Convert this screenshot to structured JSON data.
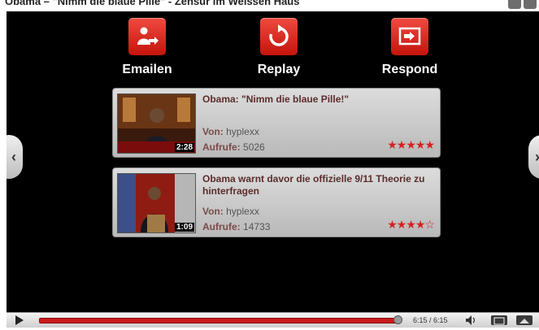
{
  "window": {
    "title": "Obama – \"Nimm die blaue Pille\" - Zensur im Weissen Haus"
  },
  "actions": {
    "email": {
      "label": "Emailen",
      "icon": "email-icon"
    },
    "replay": {
      "label": "Replay",
      "icon": "replay-icon"
    },
    "respond": {
      "label": "Respond",
      "icon": "respond-icon"
    }
  },
  "related": [
    {
      "title": "Obama: \"Nimm die blaue Pille!\"",
      "duration": "2:28",
      "from_label": "Von:",
      "from": "hyplexx",
      "views_label": "Aufrufe:",
      "views": "5026",
      "stars": "★★★★★",
      "rating": 5
    },
    {
      "title": "Obama warnt davor die offizielle 9/11 Theorie zu hinterfragen",
      "duration": "1:09",
      "from_label": "Von:",
      "from": "hyplexx",
      "views_label": "Aufrufe:",
      "views": "14733",
      "stars": "★★★★☆",
      "rating": 4.5
    }
  ],
  "nav": {
    "prev": "‹",
    "next": "›"
  },
  "controls": {
    "time": "6:15 / 6:15",
    "progress": 1.0
  },
  "colors": {
    "accent": "#d62020",
    "player_bg": "#000000",
    "card_bg": "#cfcfcf"
  }
}
